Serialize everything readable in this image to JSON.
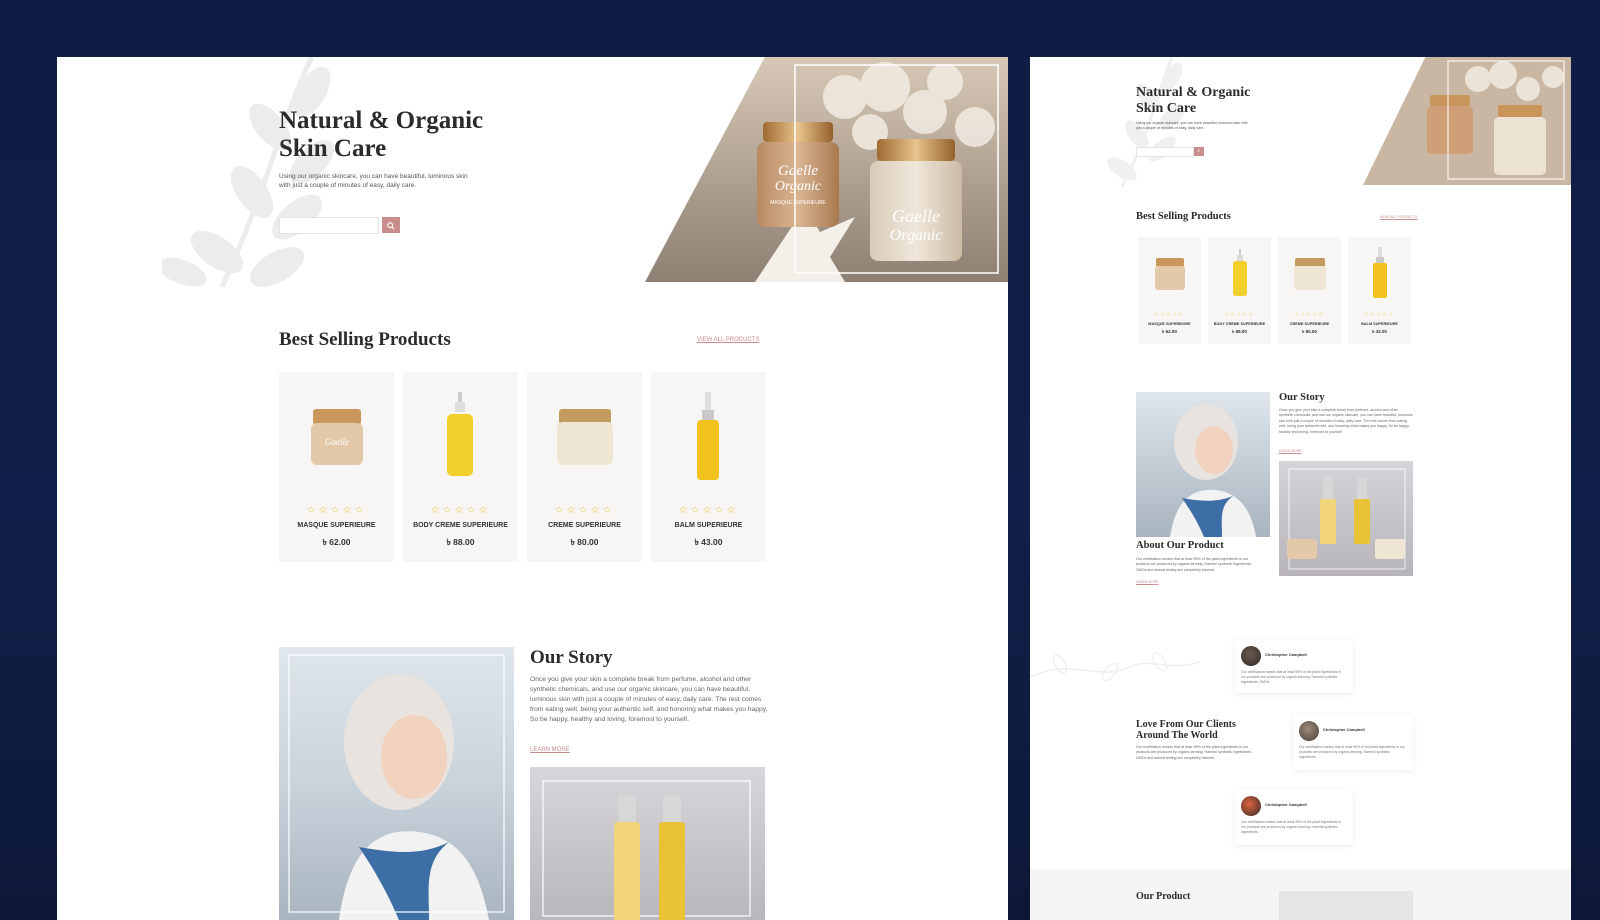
{
  "hero": {
    "title_line1": "Natural & Organic",
    "title_line2": "Skin Care",
    "description": "Using our organic skincare, you can have beautiful, luminous skin with just a couple of minutes of easy, daily care.",
    "search_placeholder": "",
    "search_icon": "search-icon",
    "jar1_brand_line1": "Gaelle",
    "jar1_brand_line2": "Organic",
    "jar1_sub": "MASQUE SUPERIEURE",
    "jar2_brand_line1": "Gaelle",
    "jar2_brand_line2": "Organic"
  },
  "best_selling": {
    "title": "Best Selling Products",
    "view_all": "VIEW ALL PRODUCTS",
    "rating_glyphs": "☆☆☆☆☆",
    "products": [
      {
        "name": "MASQUE SUPERIEURE",
        "price": "৳ 62.00",
        "rating": 0
      },
      {
        "name": "BODY CREME SUPERIEURE",
        "price": "৳ 88.00",
        "rating": 0
      },
      {
        "name": "CREME SUPERIEURE",
        "price": "৳ 80.00",
        "rating": 0
      },
      {
        "name": "BALM SUPERIEURE",
        "price": "৳ 43.00",
        "rating": 0
      }
    ]
  },
  "story": {
    "title": "Our Story",
    "text": "Once you give your skin a complete break from perfume, alcohol and other synthetic chemicals, and use our organic skincare, you can have beautiful, luminous skin with just a couple of minutes of easy, daily care. The rest comes from eating well, being your authentic self, and honoring what makes you happy. So be happy, healthy and loving, foremost to yourself.",
    "link": "LEARN MORE"
  },
  "about": {
    "title": "About Our Product",
    "text": "Our certification means that at least 95% of the plant ingredients in our products are produced by organic farming. Harmful synthetic ingredients, GMOs and animal testing are completely banned.",
    "link": "LEARN MORE"
  },
  "testimonials": {
    "title_line1": "Love From Our Clients",
    "title_line2": "Around The World",
    "text": "Our certification means that at least 95% of the plant ingredients in our products are produced by organic farming. Harmful synthetic ingredients, GMOs and animal testing are completely banned.",
    "items": [
      {
        "name": "Christopher Campbell",
        "text": "Our certification means that at least 95% of the plant ingredients in our products are produced by organic farming. Harmful synthetic ingredients, GMOs."
      },
      {
        "name": "Christopher Campbell",
        "text": "Our certification means that at least 95% of the plant ingredients in our products are produced by organic farming. Harmful synthetic ingredients."
      },
      {
        "name": "Christopher Campbell",
        "text": "Our certification means that at least 95% of the plant ingredients in our products are produced by organic farming. Harmful synthetic ingredients."
      }
    ]
  },
  "footer_section": {
    "title": "Our Product"
  },
  "colors": {
    "accent": "#c98d8d",
    "star": "#f0c23b",
    "background": "#0f1b42"
  }
}
